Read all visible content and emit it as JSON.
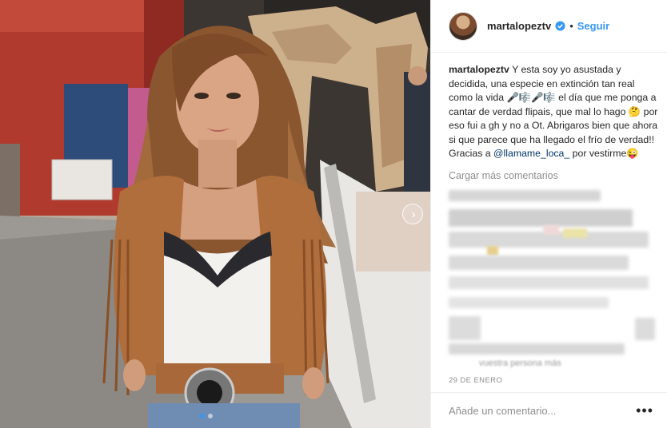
{
  "post": {
    "username": "martalopeztv",
    "follow_label": "Seguir",
    "separator": "•",
    "caption_user": "martalopeztv",
    "caption_text": "Y esta soy yo asustada y decidida, una especie en extinción tan real como la vida 🎤🎼🎤🎼 el día que me ponga a cantar de verdad flipais, que mal lo hago 🤔 por eso fui a gh y no a Ot. Abrigaros bien que ahora si que parece que ha llegado el frío de verdad!!",
    "caption_thanks_prefix": "Gracias a",
    "caption_mention": "@llamame_loca_",
    "caption_thanks_suffix": "por vestirme😜",
    "load_more": "Cargar más comentarios",
    "blurred_fragment": "vuestra persona más",
    "date": "29 DE ENERO",
    "comment_placeholder": "Añade un comentario...",
    "more_options": "•••"
  },
  "icons": {
    "verified": "verified-badge-icon",
    "next": "chevron-right-icon",
    "more": "more-options-icon"
  },
  "colors": {
    "link_blue": "#3897f0",
    "mention_blue": "#003569",
    "muted_gray": "#8e8e8e",
    "text": "#262626"
  },
  "carousel": {
    "slides": 2,
    "active": 1
  }
}
